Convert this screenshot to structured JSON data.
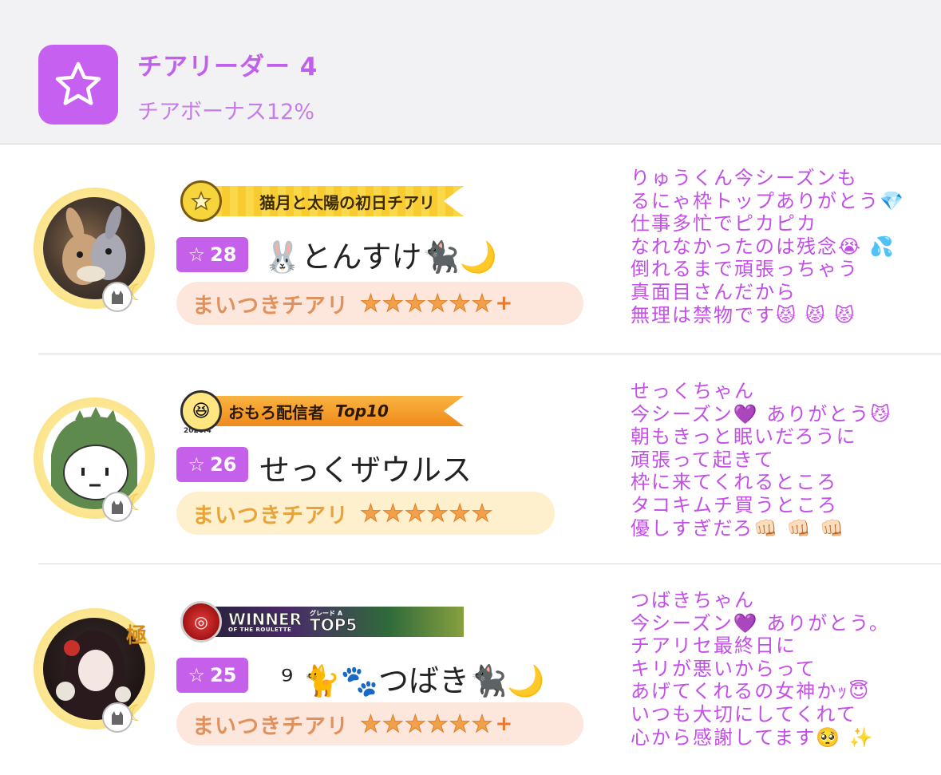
{
  "header": {
    "rank_title": "チアリーダー 4",
    "rank_subtitle": "チアボーナス12%",
    "rank_icon": "star-icon",
    "accent_color": "#c660f0"
  },
  "cheerers": [
    {
      "title_badge_text": "猫月と太陽の初日チアリ",
      "level": "28",
      "name": "🐰とんすけ🐈‍⬛🌙",
      "cheer_label": "まいつきチアリ",
      "stars": 6,
      "stars_plus": "+",
      "message": "りゅうくん今シーズンも\nるにゃ枠トップありがとう💎\n仕事多忙でピカピカ\nなれなかったのは残念😭 💦\n倒れるまで頑張っちゃう\n真面目さんだから\n無理は禁物です😾 😾 😾"
    },
    {
      "title_badge_text": "おもろ配信者",
      "title_badge_extra": "Top10",
      "title_badge_date": "2026.4",
      "level": "26",
      "name": "せっくザウルス",
      "cheer_label": "まいつきチアリ",
      "stars": 6,
      "stars_plus": "",
      "message": "せっくちゃん\n今シーズン💜 ありがとう😼\n朝もきっと眠いだろうに\n頑張って起きて\n枠に来てくれるところ\nタコキムチ買うところ\n優しすぎだろ👊🏻 👊🏻 👊🏻"
    },
    {
      "title_badge_text": "WINNER",
      "title_badge_sub": "OF THE ROULETTE",
      "title_badge_extra": "TOP5",
      "title_badge_extra_sub": "グレード A",
      "level": "25",
      "name": "⁹ 🐈🐾つばき🐈‍⬛🌙",
      "cheer_label": "まいつきチアリ",
      "stars": 6,
      "stars_plus": "+",
      "avatar_mark": "極",
      "message": "つばきちゃん\n今シーズン💜 ありがとう。\nチアリセ最終日に\nキリが悪いからって\nあげてくれるの女神かｯ😇\nいつも大切にしてくれて\n心から感謝してます🥺 ✨"
    }
  ]
}
